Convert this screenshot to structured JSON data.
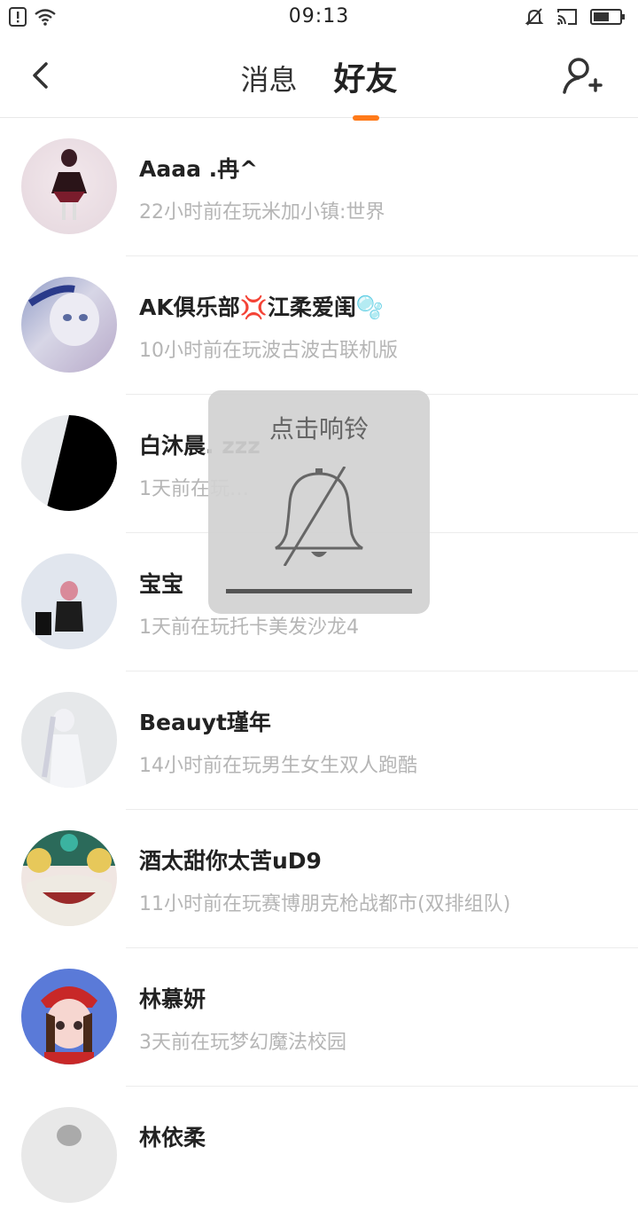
{
  "status_bar": {
    "time": "09:13"
  },
  "header": {
    "tabs": [
      {
        "label": "消息",
        "active": false
      },
      {
        "label": "好友",
        "active": true
      }
    ],
    "accent_color": "#ff7a1a"
  },
  "friends": [
    {
      "name": "Aaaa .冉^",
      "status": "22小时前在玩米加小镇:世界"
    },
    {
      "name": "AK俱乐部💢江柔爱闺🫧",
      "status": "10小时前在玩波古波古联机版"
    },
    {
      "name": "白沐晨. zzz",
      "status": "1天前在玩…"
    },
    {
      "name": "宝宝",
      "status": "1天前在玩托卡美发沙龙4"
    },
    {
      "name": "Beauyt瑾年",
      "status": "14小时前在玩男生女生双人跑酷"
    },
    {
      "name": "酒太甜你太苦uD9",
      "status": "11小时前在玩赛博朋克枪战都市(双排组队)"
    },
    {
      "name": "林慕妍",
      "status": "3天前在玩梦幻魔法校园"
    },
    {
      "name": "林依柔",
      "status": ""
    }
  ],
  "toast": {
    "title": "点击响铃",
    "icon": "bell-muted-icon"
  }
}
